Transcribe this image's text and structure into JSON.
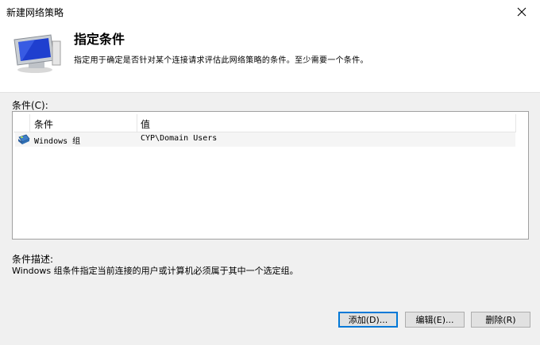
{
  "window": {
    "title": "新建网络策略",
    "close_icon": "close-icon"
  },
  "header": {
    "title": "指定条件",
    "description": "指定用于确定是否针对某个连接请求评估此网络策略的条件。至少需要一个条件。",
    "icon": "network-monitor-icon"
  },
  "conditions": {
    "label": "条件(C):",
    "columns": [
      "条件",
      "值"
    ],
    "rows": [
      {
        "icon": "windows-group-icon",
        "condition": "Windows 组",
        "value": "CYP\\Domain Users"
      }
    ]
  },
  "description_section": {
    "label": "条件描述:",
    "text": "Windows 组条件指定当前连接的用户或计算机必须属于其中一个选定组。"
  },
  "buttons": {
    "add": "添加(D)...",
    "edit": "编辑(E)...",
    "delete": "删除(R)"
  },
  "colors": {
    "accent": "#0078d7",
    "window_bg": "#f0f0f0",
    "header_bg": "#ffffff"
  }
}
